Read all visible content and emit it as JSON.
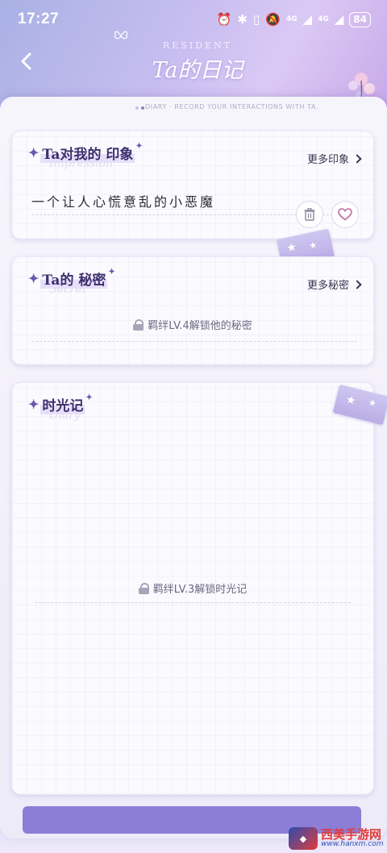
{
  "status_bar": {
    "time": "17:27",
    "network_1": "4G",
    "network_2": "4G",
    "battery": "84",
    "icons": [
      "alarm-icon",
      "bluetooth-icon",
      "vibrate-icon",
      "mute-icon",
      "signal-icon",
      "signal-icon",
      "battery-icon"
    ]
  },
  "header": {
    "subtitle": "RESIDENT",
    "title": "Ta的日记",
    "ticker": "DIARY · RECORD YOUR INTERACTIONS WITH TA."
  },
  "impression_card": {
    "title": "Ta对我的 印象",
    "ghost": "Impression",
    "more_label": "更多印象",
    "impression_text": "一个让人心慌意乱的小恶魔"
  },
  "secret_card": {
    "title": "Ta的 秘密",
    "ghost": "Secret",
    "more_label": "更多秘密",
    "locked_text": "羁绊LV.4解锁他的秘密"
  },
  "time_card": {
    "title": "时光记",
    "ghost": "Diary",
    "locked_text": "羁绊LV.3解锁时光记"
  },
  "watermark": {
    "name": "西美手游网",
    "url": "www.hanxm.com"
  },
  "colors": {
    "accent": "#6b58b0",
    "title": "#3d2f6e",
    "heart": "#c06aa0"
  }
}
